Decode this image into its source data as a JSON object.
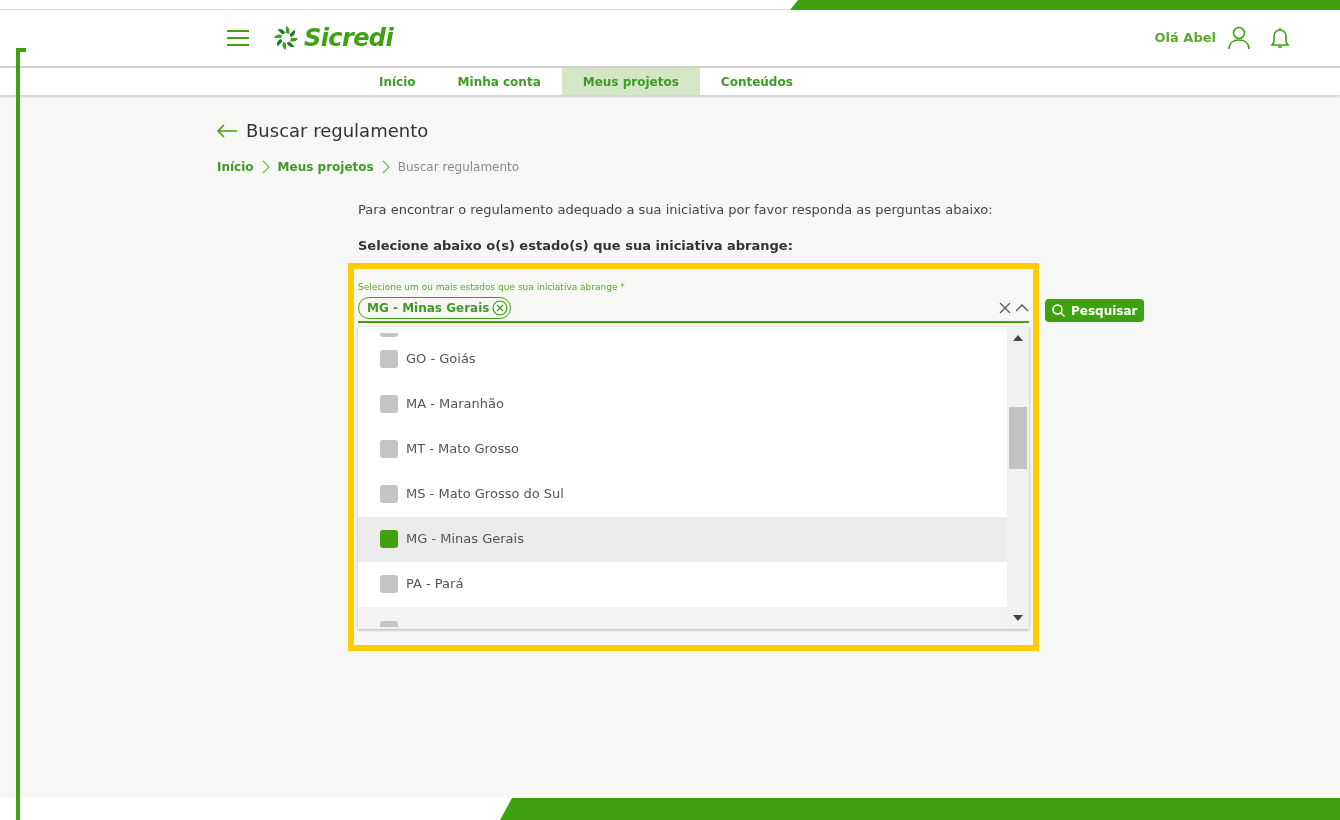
{
  "header": {
    "brand": "Sicredi",
    "greeting": "Olá Abel"
  },
  "nav": [
    {
      "label": "Início",
      "selected": false
    },
    {
      "label": "Minha conta",
      "selected": false
    },
    {
      "label": "Meus projetos",
      "selected": true
    },
    {
      "label": "Conteúdos",
      "selected": false
    }
  ],
  "page_title": "Buscar regulamento",
  "breadcrumb": [
    {
      "label": "Início",
      "current": false
    },
    {
      "label": "Meus projetos",
      "current": false
    },
    {
      "label": "Buscar regulamento",
      "current": true
    }
  ],
  "intro": "Para encontrar o regulamento adequado a sua iniciativa por favor responda as perguntas abaixo:",
  "question": "Selecione abaixo o(s) estado(s) que sua iniciativa abrange:",
  "select": {
    "label": "Selecione um ou mais estados que sua iniciativa abrange *",
    "chips": [
      "MG - Minas Gerais"
    ],
    "expanded": true
  },
  "search_button": "Pesquisar",
  "clipped_options": [
    {
      "checked": false
    },
    {
      "checked": false
    }
  ],
  "options": [
    {
      "label": "GO - Goiás",
      "checked": false,
      "selected": false
    },
    {
      "label": "MA - Maranhão",
      "checked": false,
      "selected": false
    },
    {
      "label": "MT - Mato Grosso",
      "checked": false,
      "selected": false
    },
    {
      "label": "MS - Mato Grosso do Sul",
      "checked": false,
      "selected": false
    },
    {
      "label": "MG - Minas Gerais",
      "checked": true,
      "selected": true
    },
    {
      "label": "PA - Pará",
      "checked": false,
      "selected": false
    }
  ]
}
